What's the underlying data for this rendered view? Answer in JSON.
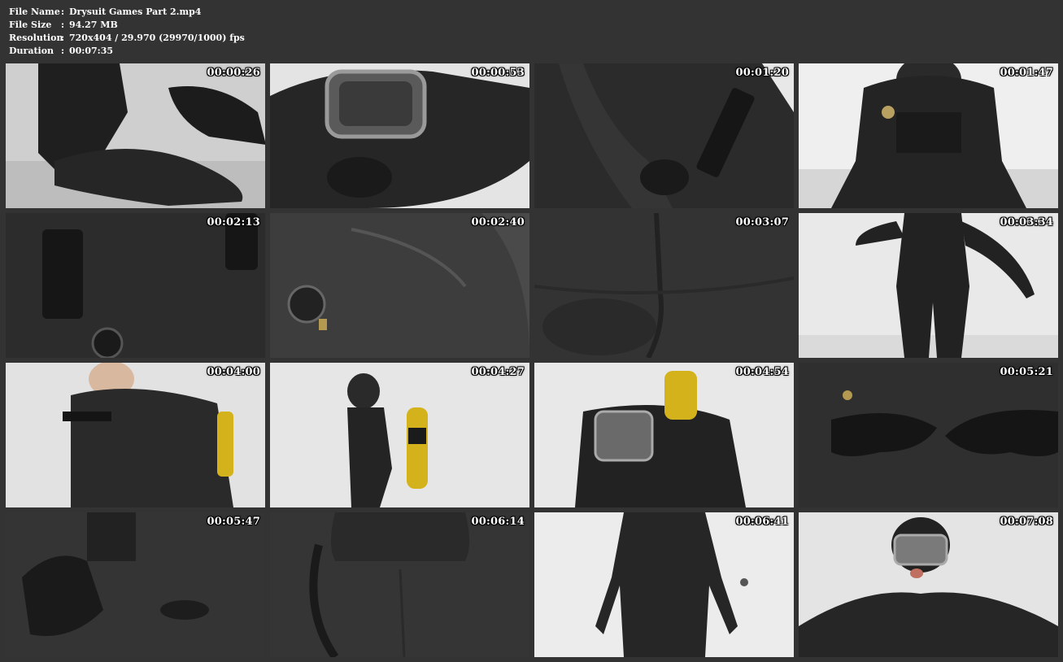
{
  "meta": {
    "file_name": {
      "label": "File Name",
      "value": "Drysuit Games Part 2.mp4"
    },
    "file_size": {
      "label": "File Size",
      "value": "94.27 MB"
    },
    "resolution": {
      "label": "Resolution",
      "value": "720x404 / 29.970 (29970/1000) fps"
    },
    "duration": {
      "label": "Duration",
      "value": "00:07:35"
    },
    "separator": ":"
  },
  "thumbnails": [
    {
      "timestamp": "00:00:26",
      "scene": "black rubber drysuit legs and boots kneeling on white floor"
    },
    {
      "timestamp": "00:00:53",
      "scene": "diver in full-face mask lying on white floor"
    },
    {
      "timestamp": "00:01:20",
      "scene": "close-up of drysuit torso with harness strap and gloved hand"
    },
    {
      "timestamp": "00:01:47",
      "scene": "diver in black drysuit kneeling with harness and gauges"
    },
    {
      "timestamp": "00:02:13",
      "scene": "close-up of drysuit chest with harness buckles and valve"
    },
    {
      "timestamp": "00:02:40",
      "scene": "close-up of drysuit inflator valve on chest"
    },
    {
      "timestamp": "00:03:07",
      "scene": "close-up of drysuit crotch seams"
    },
    {
      "timestamp": "00:03:34",
      "scene": "diver standing in black drysuit, arms out"
    },
    {
      "timestamp": "00:04:00",
      "scene": "side view of diver with yellow tank on back"
    },
    {
      "timestamp": "00:04:27",
      "scene": "diver walking with yellow scuba tank"
    },
    {
      "timestamp": "00:04:54",
      "scene": "diver with mask and yellow tank against white wall"
    },
    {
      "timestamp": "00:05:21",
      "scene": "gloved hands on drysuit torso"
    },
    {
      "timestamp": "00:05:47",
      "scene": "close-up of glove and chest valve"
    },
    {
      "timestamp": "00:06:14",
      "scene": "close-up of drysuit neck seal and hose"
    },
    {
      "timestamp": "00:06:41",
      "scene": "diver standing in full black drysuit"
    },
    {
      "timestamp": "00:07:08",
      "scene": "diver with full-face mask and inflated arms"
    }
  ],
  "colors": {
    "background": "#333333",
    "text": "#ffffff",
    "rubber": "#1e1e1e",
    "wall": "#d9d9d9",
    "tank": "#d4b21c"
  }
}
